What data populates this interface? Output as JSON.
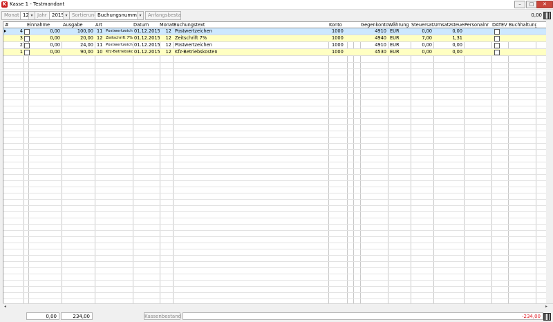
{
  "window": {
    "title": "Kasse 1 - Testmandant",
    "logo_letter": "K",
    "min": "–",
    "max": "□",
    "close": "✕"
  },
  "toolbar": {
    "monat_label": "Monat",
    "monat_value": "12",
    "jahr_label": "Jahr",
    "jahr_value": "2015",
    "sortierung_label": "Sortierung",
    "sortierung_value": "Buchungsnummer",
    "anfangsbestand_label": "Anfangsbestand",
    "amount": "0,00",
    "dropdown_arrow": "▾"
  },
  "table": {
    "columns": {
      "num": "#",
      "einnahme": "Einnahme",
      "ausgabe": "Ausgabe",
      "art": "Art",
      "datum": "Datum",
      "monat": "Monat",
      "buchungstext": "Buchungstext",
      "konto": "Konto",
      "gegenkonto": "Gegenkonto",
      "waehrung": "Währung",
      "steuersatz": "Steuersatz",
      "umsatzsteuer": "Umsatzsteuer",
      "personalnr": "Personalnr",
      "datev": "DATEV",
      "buchhaltung": "Buchhaltung"
    },
    "rows": [
      {
        "num": "4",
        "einnahme": "0,00",
        "ausgabe": "100,00",
        "art_code": "11",
        "art_name": "Postwertzeich",
        "datum": "01.12.2015",
        "monat": "12",
        "text": "Postwertzeichen",
        "konto": "1000",
        "gegenkonto": "4910",
        "waehrung": "EUR",
        "steuersatz": "0,00",
        "umsatzsteuer": "0,00"
      },
      {
        "num": "3",
        "einnahme": "0,00",
        "ausgabe": "20,00",
        "art_code": "12",
        "art_name": "Zeitschrift 7%",
        "datum": "01.12.2015",
        "monat": "12",
        "text": "Zeitschrift 7%",
        "konto": "1000",
        "gegenkonto": "4940",
        "waehrung": "EUR",
        "steuersatz": "7,00",
        "umsatzsteuer": "1,31"
      },
      {
        "num": "2",
        "einnahme": "0,00",
        "ausgabe": "24,00",
        "art_code": "11",
        "art_name": "Postwertzeich",
        "datum": "01.12.2015",
        "monat": "12",
        "text": "Postwertzeichen",
        "konto": "1000",
        "gegenkonto": "4910",
        "waehrung": "EUR",
        "steuersatz": "0,00",
        "umsatzsteuer": "0,00"
      },
      {
        "num": "1",
        "einnahme": "0,00",
        "ausgabe": "90,00",
        "art_code": "10",
        "art_name": "Kfz-Betriebsko",
        "datum": "01.12.2015",
        "monat": "12",
        "text": "Kfz-Betriebskosten",
        "konto": "1000",
        "gegenkonto": "4530",
        "waehrung": "EUR",
        "steuersatz": "0,00",
        "umsatzsteuer": "0,00"
      }
    ]
  },
  "footer": {
    "sum_einnahme": "0,00",
    "sum_ausgabe": "234,00",
    "kassenbestand_label": "Kassenbestand",
    "kassenbestand_value": "-234,00"
  },
  "colors": {
    "selected_row": "#cde8ff",
    "highlight_row": "#ffffc2",
    "negative": "#e0141e",
    "logo": "#cc1e1e"
  },
  "icons": {
    "calculator": "calculator-icon",
    "logo": "app-logo-icon"
  }
}
